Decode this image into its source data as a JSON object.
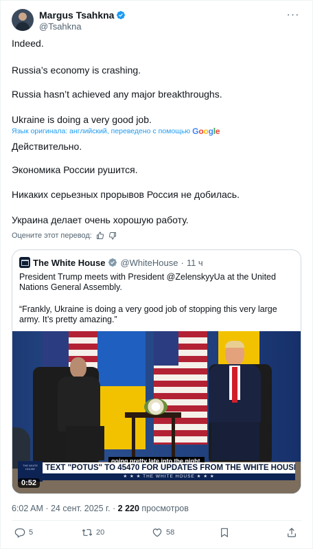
{
  "author": {
    "name": "Margus Tsahkna",
    "handle": "@Tsahkna"
  },
  "post": {
    "lines": [
      "Indeed.",
      "Russia’s economy is crashing.",
      "Russia hasn’t achieved any major breakthroughs.",
      "Ukraine is doing a very good job."
    ],
    "translation_note": "Язык оригинала: английский, переведено с помощью",
    "translation_brand": [
      "G",
      "o",
      "o",
      "g",
      "l",
      "e"
    ],
    "translated_lines": [
      "Действительно.",
      "Экономика России рушится.",
      "Никаких серьезных прорывов Россия не добилась.",
      "Украина делает очень хорошую работу."
    ],
    "rate_translation": "Оцените этот перевод:"
  },
  "quote": {
    "name": "The White House",
    "handle": "@WhiteHouse",
    "separator": "·",
    "time": "11 ч",
    "text1": "President Trump meets with President @ZelenskyyUa at the United Nations General Assembly.",
    "text2": "“Frankly, Ukraine is doing a very good job of stopping this very large army. It’s pretty amazing.”",
    "video": {
      "caption": "going pretty late into the night.",
      "banner": "TEXT \"POTUS\" TO 45470 FOR UPDATES FROM THE WHITE HOUSE",
      "banner_sub": "★ ★ ★  THE WHITE HOUSE  ★ ★ ★",
      "seal_text": "THE WHITE HOUSE",
      "duration": "0:52"
    }
  },
  "meta": {
    "time": "6:02 AM",
    "sep1": " · ",
    "date": "24 сент. 2025 г.",
    "sep2": " · ",
    "views": "2 220",
    "views_label": " просмотров"
  },
  "actions": {
    "replies": "5",
    "reposts": "20",
    "likes": "58"
  },
  "colors": {
    "accent": "#1d9bf0",
    "verified": "#1d9bf0",
    "text": "#0f1419",
    "muted": "#536471",
    "border": "#cfd9de"
  },
  "icons": [
    "verified-badge-icon",
    "more-icon",
    "thumbs-up-icon",
    "thumbs-down-icon",
    "reply-icon",
    "repost-icon",
    "like-icon",
    "bookmark-icon",
    "share-icon"
  ]
}
